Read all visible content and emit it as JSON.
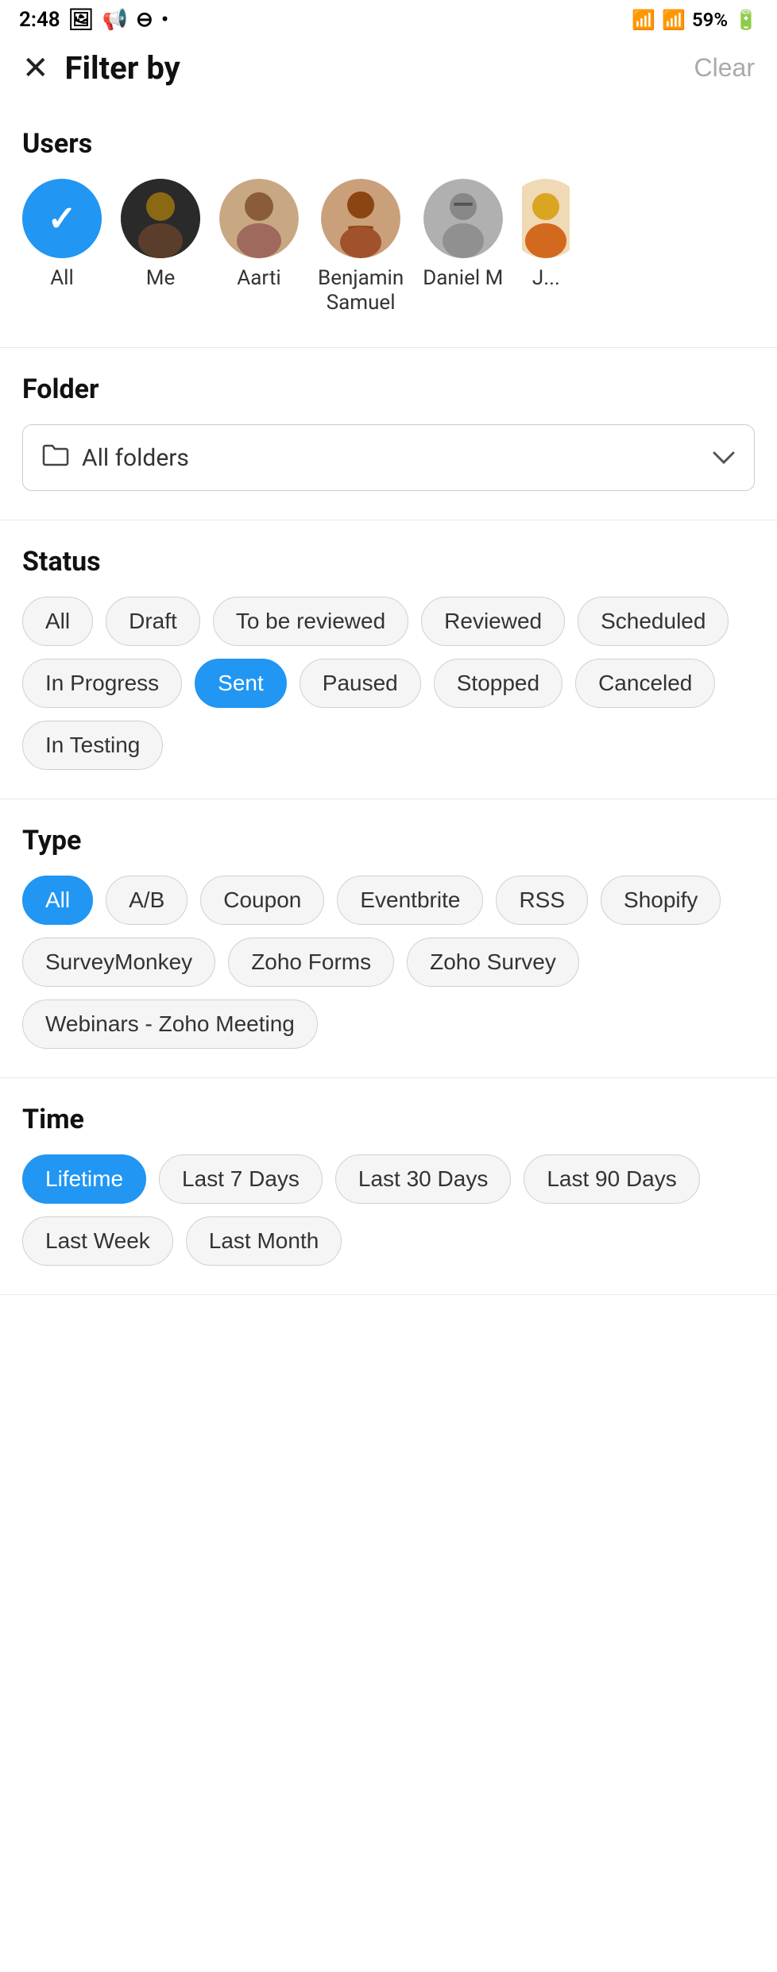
{
  "statusBar": {
    "time": "2:48",
    "battery": "59%",
    "icons": [
      "image",
      "notification",
      "minus",
      "dot"
    ]
  },
  "header": {
    "title": "Filter by",
    "clearLabel": "Clear"
  },
  "users": {
    "sectionTitle": "Users",
    "items": [
      {
        "id": "all",
        "label": "All",
        "selected": true
      },
      {
        "id": "me",
        "label": "Me",
        "selected": false
      },
      {
        "id": "aarti",
        "label": "Aarti",
        "selected": false
      },
      {
        "id": "benjamin",
        "label": "Benjamin\nSamuel",
        "selected": false
      },
      {
        "id": "daniel",
        "label": "Daniel M",
        "selected": false
      },
      {
        "id": "ja",
        "label": "J...",
        "selected": false
      }
    ]
  },
  "folder": {
    "sectionTitle": "Folder",
    "value": "All folders",
    "placeholder": "All folders"
  },
  "status": {
    "sectionTitle": "Status",
    "items": [
      {
        "id": "all",
        "label": "All",
        "active": false
      },
      {
        "id": "draft",
        "label": "Draft",
        "active": false
      },
      {
        "id": "to-be-reviewed",
        "label": "To be reviewed",
        "active": false
      },
      {
        "id": "reviewed",
        "label": "Reviewed",
        "active": false
      },
      {
        "id": "scheduled",
        "label": "Scheduled",
        "active": false
      },
      {
        "id": "in-progress",
        "label": "In Progress",
        "active": false
      },
      {
        "id": "sent",
        "label": "Sent",
        "active": true
      },
      {
        "id": "paused",
        "label": "Paused",
        "active": false
      },
      {
        "id": "stopped",
        "label": "Stopped",
        "active": false
      },
      {
        "id": "canceled",
        "label": "Canceled",
        "active": false
      },
      {
        "id": "in-testing",
        "label": "In Testing",
        "active": false
      }
    ]
  },
  "type": {
    "sectionTitle": "Type",
    "items": [
      {
        "id": "all",
        "label": "All",
        "active": true
      },
      {
        "id": "ab",
        "label": "A/B",
        "active": false
      },
      {
        "id": "coupon",
        "label": "Coupon",
        "active": false
      },
      {
        "id": "eventbrite",
        "label": "Eventbrite",
        "active": false
      },
      {
        "id": "rss",
        "label": "RSS",
        "active": false
      },
      {
        "id": "shopify",
        "label": "Shopify",
        "active": false
      },
      {
        "id": "surveymonkey",
        "label": "SurveyMonkey",
        "active": false
      },
      {
        "id": "zoho-forms",
        "label": "Zoho Forms",
        "active": false
      },
      {
        "id": "zoho-survey",
        "label": "Zoho Survey",
        "active": false
      },
      {
        "id": "webinars",
        "label": "Webinars - Zoho Meeting",
        "active": false
      }
    ]
  },
  "time": {
    "sectionTitle": "Time",
    "items": [
      {
        "id": "lifetime",
        "label": "Lifetime",
        "active": true
      },
      {
        "id": "last7days",
        "label": "Last 7 Days",
        "active": false
      },
      {
        "id": "last30days",
        "label": "Last 30 Days",
        "active": false
      },
      {
        "id": "last90days",
        "label": "Last 90 Days",
        "active": false
      },
      {
        "id": "lastweek",
        "label": "Last Week",
        "active": false
      },
      {
        "id": "lastmonth",
        "label": "Last Month",
        "active": false
      }
    ]
  }
}
